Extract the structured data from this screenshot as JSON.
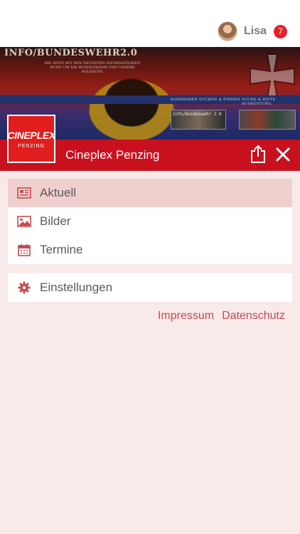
{
  "user": {
    "name": "Lisa",
    "notification_count": "7"
  },
  "banner": {
    "title": "INFO/BUNDESWEHR2.0",
    "subtitle": "DIE SEITE MIT DEN NEUESTEN INFORMATIONEN RUND UM DIE BUNDESWEHR UND UNSERE SOLDATEN.",
    "link_left": "KAMERADEN SUCHEN & FINDEN",
    "link_right": "SUCHE & BIETE AUSRÜSTUNG",
    "thumb_left": "Info/Bundeswehr 2.0"
  },
  "header": {
    "logo_main": "CINEPLEX",
    "logo_sub": "PENZING",
    "title": "Cineplex Penzing",
    "share_icon": "share-icon",
    "close_icon": "close-icon"
  },
  "menu": [
    {
      "label": "Aktuell",
      "icon": "newspaper-icon",
      "active": true
    },
    {
      "label": "Bilder",
      "icon": "image-icon",
      "active": false
    },
    {
      "label": "Termine",
      "icon": "calendar-icon",
      "active": false
    }
  ],
  "settings": {
    "label": "Einstellungen",
    "icon": "gear-icon"
  },
  "footer": {
    "impressum": "Impressum",
    "datenschutz": "Datenschutz"
  },
  "colors": {
    "header_red": "#c8101e",
    "accent_text": "#c64a52",
    "background": "#f9eaea",
    "active_item": "#f0cfcf",
    "badge": "#e3202c"
  }
}
